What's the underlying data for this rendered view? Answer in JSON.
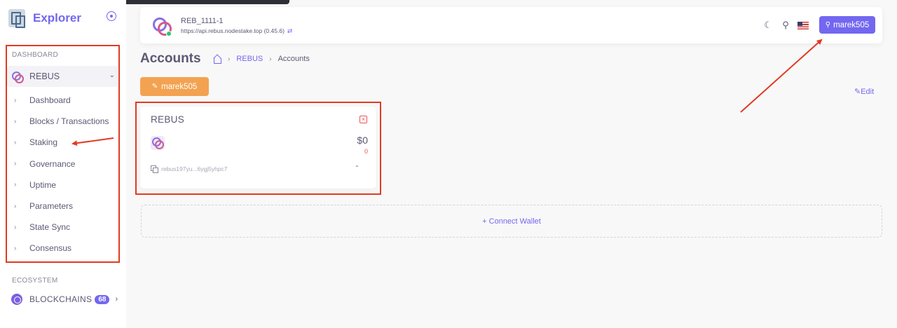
{
  "app": {
    "title": "Explorer"
  },
  "sidebar": {
    "dashboard_section": "DASHBOARD",
    "chain": {
      "label": "REBUS"
    },
    "items": [
      {
        "label": "Dashboard"
      },
      {
        "label": "Blocks / Transactions"
      },
      {
        "label": "Staking"
      },
      {
        "label": "Governance"
      },
      {
        "label": "Uptime"
      },
      {
        "label": "Parameters"
      },
      {
        "label": "State Sync"
      },
      {
        "label": "Consensus"
      }
    ],
    "ecosystem_section": "ECOSYSTEM",
    "ecosystem_item": {
      "label": "BLOCKCHAINS",
      "badge": "68"
    }
  },
  "header": {
    "chain_id": "REB_1111-1",
    "rpc_url": "https://api.rebus.nodestake.top (0.45.6)",
    "user_button": "marek505"
  },
  "page": {
    "title": "Accounts",
    "breadcrumb": {
      "chain": "REBUS",
      "current": "Accounts"
    },
    "account_button": "marek505",
    "edit_link": "Edit"
  },
  "account_card": {
    "chain_name": "REBUS",
    "value": "$0",
    "sub_value": "0",
    "address": "rebus197yu...6ygj5yhpc7"
  },
  "connect_wallet": {
    "label": "+ Connect Wallet"
  },
  "colors": {
    "accent": "#7367f0",
    "orange": "#f3a251",
    "annotation": "#e03b22",
    "online": "#28c76f"
  },
  "icons": [
    "brand-logo-icon",
    "settings-circle-icon",
    "chevron-down-icon",
    "chevron-right-icon",
    "moon-icon",
    "search-icon",
    "us-flag-icon",
    "key-icon",
    "home-icon",
    "edit-icon",
    "close-square-icon",
    "copy-icon",
    "chevron-up-icon"
  ]
}
